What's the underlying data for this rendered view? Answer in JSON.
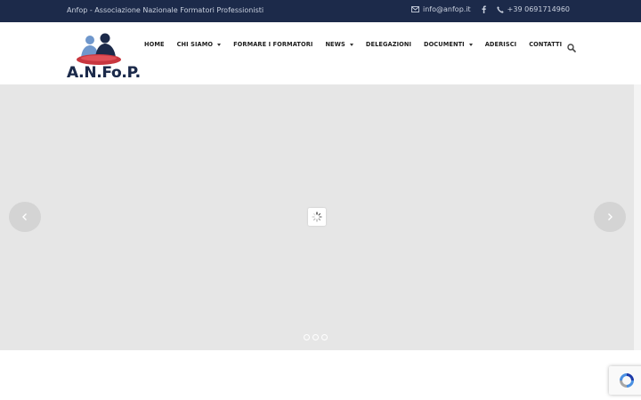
{
  "topbar": {
    "tagline": "Anfop - Associazione Nazionale Formatori Professionisti",
    "email": "info@anfop.it",
    "phone": "+39 0691714960",
    "icons": [
      "envelope-icon",
      "facebook-icon",
      "phone-icon"
    ]
  },
  "logo": {
    "text": "A.N.Fo.P."
  },
  "nav": {
    "items": [
      {
        "label": "HOME",
        "dropdown": false
      },
      {
        "label": "CHI SIAMO",
        "dropdown": true
      },
      {
        "label": "FORMARE I FORMATORI",
        "dropdown": false
      },
      {
        "label": "NEWS",
        "dropdown": true
      },
      {
        "label": "DELEGAZIONI",
        "dropdown": false
      },
      {
        "label": "DOCUMENTI",
        "dropdown": true
      },
      {
        "label": "ADERISCI",
        "dropdown": false
      },
      {
        "label": "CONTATTI",
        "dropdown": false
      }
    ]
  },
  "slider": {
    "slides": 3
  },
  "colors": {
    "topbar": "#1c2a4a",
    "slider_bg": "#e6e6e6",
    "logo_red": "#c8363e",
    "logo_blue": "#2f5e9e",
    "logo_navy": "#1c2a4a"
  }
}
